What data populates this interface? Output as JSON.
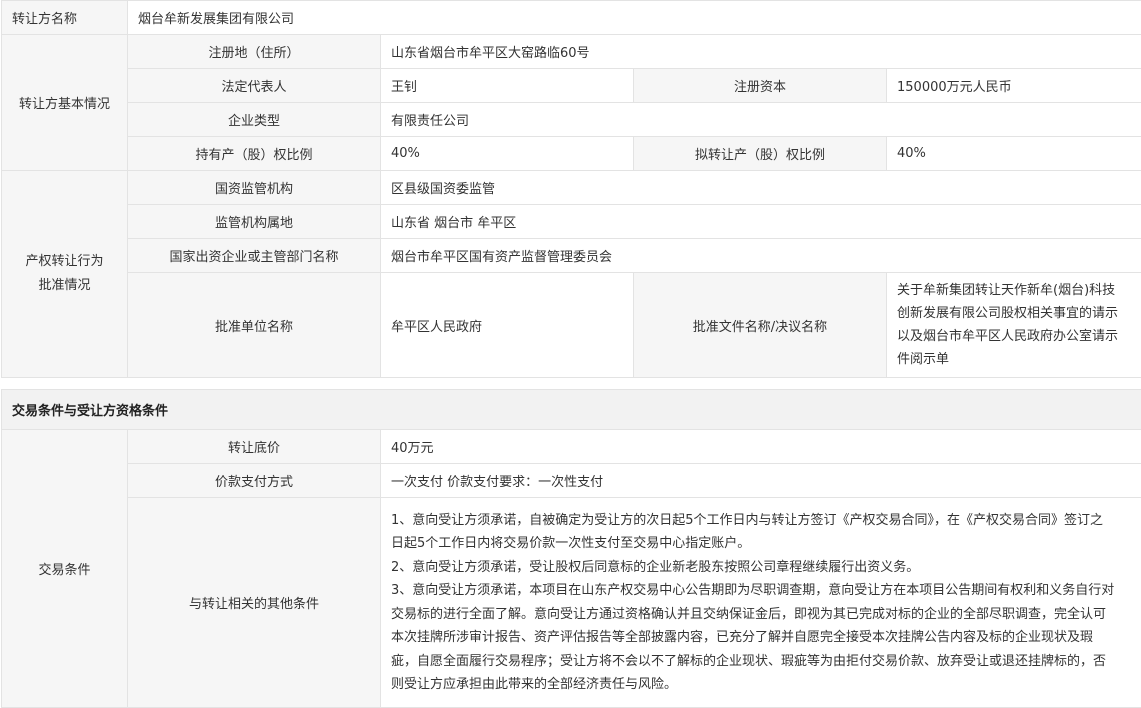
{
  "transferor": {
    "name_label": "转让方名称",
    "name_value": "烟台牟新发展集团有限公司",
    "basic_label": "转让方基本情况",
    "address_label": "注册地（住所）",
    "address_value": "山东省烟台市牟平区大窑路临60号",
    "legal_rep_label": "法定代表人",
    "legal_rep_value": "王钊",
    "capital_label": "注册资本",
    "capital_value": "150000万元人民币",
    "type_label": "企业类型",
    "type_value": "有限责任公司",
    "hold_ratio_label": "持有产（股）权比例",
    "hold_ratio_value": "40%",
    "transfer_ratio_label": "拟转让产（股）权比例",
    "transfer_ratio_value": "40%"
  },
  "approval": {
    "section_label_line1": "产权转让行为",
    "section_label_line2": "批准情况",
    "supervisor_label": "国资监管机构",
    "supervisor_value": "区县级国资委监管",
    "region_label": "监管机构属地",
    "region_value": "山东省 烟台市 牟平区",
    "dept_label": "国家出资企业或主管部门名称",
    "dept_value": "烟台市牟平区国有资产监督管理委员会",
    "unit_label": "批准单位名称",
    "unit_value": "牟平区人民政府",
    "doc_label": "批准文件名称/决议名称",
    "doc_value_line1": "关于牟新集团转让天作新牟(烟台)科技",
    "doc_value_line2": "创新发展有限公司股权相关事宜的请示",
    "doc_value_line3": "以及烟台市牟平区人民政府办公室请示",
    "doc_value_line4": "件阅示单"
  },
  "trade": {
    "section_title": "交易条件与受让方资格条件",
    "conditions_label": "交易条件",
    "price_label": "转让底价",
    "price_value": "40万元",
    "payment_label": "价款支付方式",
    "payment_value": "一次支付 价款支付要求：一次性支付",
    "other_label": "与转让相关的其他条件",
    "other_lines": [
      "1、意向受让方须承诺，自被确定为受让方的次日起5个工作日内与转让方签订《产权交易合同》，在《产权交易合同》签订之",
      "日起5个工作日内将交易价款一次性支付至交易中心指定账户。",
      "2、意向受让方须承诺，受让股权后同意标的企业新老股东按照公司章程继续履行出资义务。",
      "3、意向受让方须承诺，本项目在山东产权交易中心公告期即为尽职调查期，意向受让方在本项目公告期间有权利和义务自行对",
      "交易标的进行全面了解。意向受让方通过资格确认并且交纳保证金后，即视为其已完成对标的企业的全部尽职调查，完全认可",
      "本次挂牌所涉审计报告、资产评估报告等全部披露内容，已充分了解并自愿完全接受本次挂牌公告内容及标的企业现状及瑕",
      "疵，自愿全面履行交易程序；受让方将不会以不了解标的企业现状、瑕疵等为由拒付交易价款、放弃受让或退还挂牌标的，否",
      "则受让方应承担由此带来的全部经济责任与风险。"
    ]
  }
}
